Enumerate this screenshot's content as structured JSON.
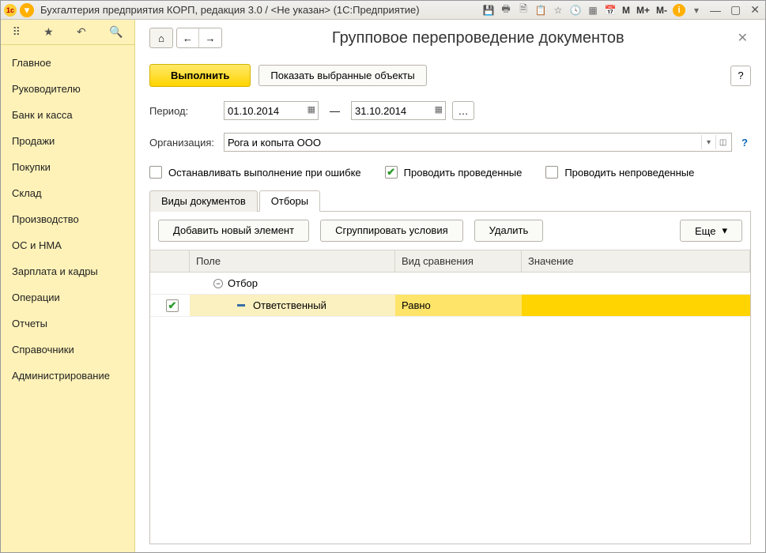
{
  "titlebar": {
    "title": "Бухгалтерия предприятия КОРП, редакция 3.0 / <Не указан>  (1С:Предприятие)",
    "mem": {
      "m": "M",
      "mplus": "M+",
      "mminus": "M-"
    }
  },
  "sidebar": {
    "items": [
      "Главное",
      "Руководителю",
      "Банк и касса",
      "Продажи",
      "Покупки",
      "Склад",
      "Производство",
      "ОС и НМА",
      "Зарплата и кадры",
      "Операции",
      "Отчеты",
      "Справочники",
      "Администрирование"
    ]
  },
  "main": {
    "title": "Групповое перепроведение документов",
    "execute": "Выполнить",
    "show_selected": "Показать выбранные объекты",
    "help": "?",
    "period_label": "Период:",
    "date_from": "01.10.2014",
    "date_to": "31.10.2014",
    "dash": "—",
    "org_label": "Организация:",
    "org_value": "Рога и копыта ООО",
    "check_stop": "Останавливать выполнение при ошибке",
    "check_posted": "Проводить проведенные",
    "check_unposted": "Проводить непроведенные",
    "tabs": {
      "kinds": "Виды документов",
      "filters": "Отборы"
    },
    "panel": {
      "add": "Добавить новый элемент",
      "group": "Сгруппировать условия",
      "delete": "Удалить",
      "more": "Еще"
    },
    "grid": {
      "col_field": "Поле",
      "col_cmp": "Вид сравнения",
      "col_val": "Значение",
      "row_group": "Отбор",
      "row_item_field": "Ответственный",
      "row_item_cmp": "Равно",
      "row_item_val": ""
    }
  }
}
